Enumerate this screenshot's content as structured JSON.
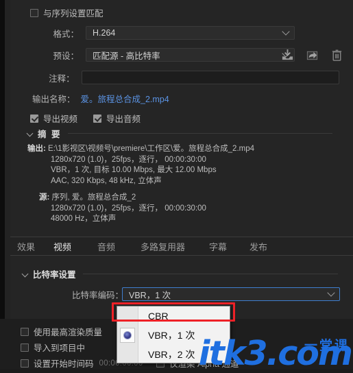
{
  "app": {
    "match_sequence_label": "与序列设置匹配"
  },
  "fields": {
    "format_label": "格式：",
    "format_value": "H.264",
    "preset_label": "预设：",
    "preset_value": "匹配源 - 高比特率",
    "comment_label": "注释：",
    "comment_value": "",
    "output_name_label": "输出名称：",
    "output_name_value": "爱。旅程总合成_2.mp4",
    "export_video_label": "导出视频",
    "export_audio_label": "导出音频"
  },
  "preset_actions": [
    {
      "name": "save-preset-icon",
      "title": "保存预设"
    },
    {
      "name": "import-preset-icon",
      "title": "导入预设"
    },
    {
      "name": "delete-preset-icon",
      "title": "删除预设"
    }
  ],
  "summary": {
    "title": "摘 要",
    "output_key": "输出:",
    "output_path": "E:\\1影视区\\视频号\\premiere\\工作区\\爱。旅程总合成_2.mp4",
    "output_lines": [
      "1280x720  (1.0)，25fps，逐行， 00:00:30:00",
      "VBR，1 次, 目标 10.00 Mbps, 最大 12.00 Mbps",
      "AAC, 320 Kbps, 48  kHz, 立体声"
    ],
    "source_key": "源:",
    "source_value": "序列, 爱。旅程总合成_2",
    "source_lines": [
      "1280x720  (1.0)，25fps，逐行， 00:00:30:00",
      "48000 Hz，立体声"
    ]
  },
  "tabs": [
    {
      "label": "效果",
      "active": false
    },
    {
      "label": "视频",
      "active": true
    },
    {
      "label": "音频",
      "active": false
    },
    {
      "label": "多路复用器",
      "active": false
    },
    {
      "label": "字幕",
      "active": false
    },
    {
      "label": "发布",
      "active": false
    }
  ],
  "video": {
    "section_title": "比特率设置",
    "bitrate_encoding_label": "比特率编码：",
    "bitrate_encoding_value": "VBR，1 次"
  },
  "dropdown": {
    "items": [
      {
        "label": "CBR",
        "selected": false,
        "highlighted": true
      },
      {
        "label": "VBR，1 次",
        "selected": true,
        "highlighted": false
      },
      {
        "label": "VBR，2 次",
        "selected": false,
        "highlighted": false
      }
    ]
  },
  "bottom_options": [
    {
      "label": "使用最高渲染质量",
      "checked": false
    },
    {
      "label": "导入到项目中",
      "checked": false
    },
    {
      "label": "设置开始时间码",
      "checked": false,
      "timecode": "00:00:00:00"
    },
    {
      "label": "仅渲染 Alpha 通道",
      "checked": false
    }
  ],
  "watermark": {
    "main": "itk3.com",
    "sub": "一堂课",
    "color": "#1f6fe0"
  },
  "colors": {
    "panel_bg": "#252525",
    "window_bg": "#1c1c1c",
    "accent_link": "#5b93e3",
    "focus_border": "#3f7fd0",
    "annotation_red": "#ee2127"
  }
}
